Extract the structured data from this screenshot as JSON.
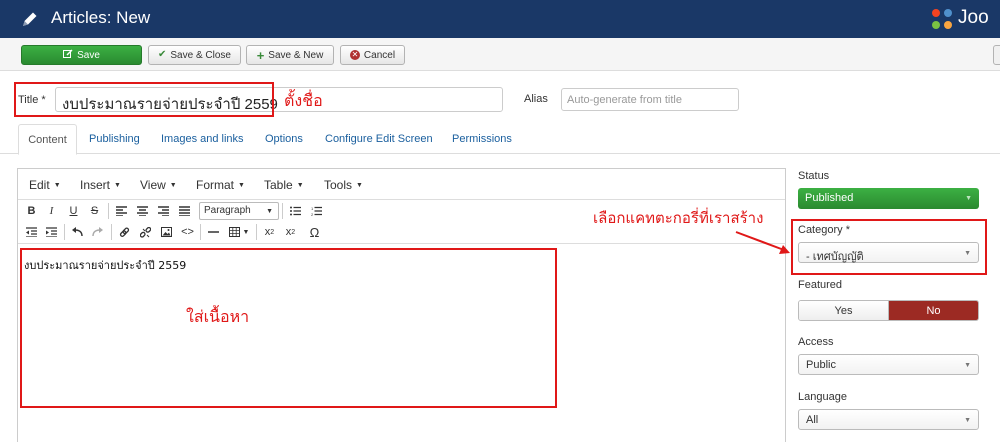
{
  "header": {
    "title": "Articles: New",
    "logo_text": "Joo"
  },
  "toolbar": {
    "save": "Save",
    "save_close": "Save & Close",
    "save_new": "Save & New",
    "cancel": "Cancel"
  },
  "form": {
    "title_label": "Title *",
    "title_value": "งบประมาณรายจ่ายประจำปี 2559",
    "alias_label": "Alias",
    "alias_placeholder": "Auto-generate from title"
  },
  "annotations": {
    "name_it": "ตั้งชื่อ",
    "choose_category": "เลือกแคทตะกอรี่ที่เราสร้าง",
    "add_content": "ใส่เนื้อหา"
  },
  "tabs": [
    "Content",
    "Publishing",
    "Images and links",
    "Options",
    "Configure Edit Screen",
    "Permissions"
  ],
  "editor": {
    "menus": [
      "Edit",
      "Insert",
      "View",
      "Format",
      "Table",
      "Tools"
    ],
    "format_select": "Paragraph",
    "content": "งบประมาณรายจ่ายประจำปี 2559"
  },
  "sidebar": {
    "status_label": "Status",
    "status_value": "Published",
    "category_label": "Category *",
    "category_value": "- เทศบัญญัติ",
    "featured_label": "Featured",
    "featured_yes": "Yes",
    "featured_no": "No",
    "featured_selected": "No",
    "access_label": "Access",
    "access_value": "Public",
    "language_label": "Language",
    "language_value": "All"
  },
  "colors": {
    "header_bg": "#1a3867",
    "save_green": "#2f9e36",
    "annotation_red": "#e01818",
    "no_selected": "#9c2a23"
  }
}
